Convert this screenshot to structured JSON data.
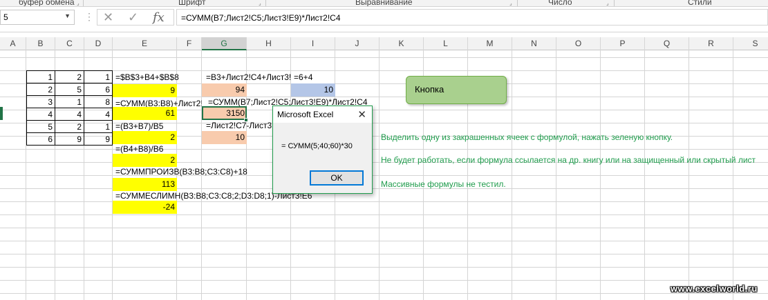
{
  "ribbon": {
    "groups": [
      "буфер обмена",
      "Шрифт",
      "Выравнивание",
      "Число",
      "Стили"
    ]
  },
  "formula_bar": {
    "name_box": "5",
    "cancel_icon": "✕",
    "enter_icon": "✓",
    "fx_label": "fx",
    "formula": "=СУММ(B7;Лист2!C5;Лист3!E9)*Лист2!C4"
  },
  "columns": [
    "A",
    "B",
    "C",
    "D",
    "E",
    "F",
    "G",
    "H",
    "I",
    "J",
    "K",
    "L",
    "M",
    "N",
    "O",
    "P",
    "Q",
    "R",
    "S"
  ],
  "selected_column": "G",
  "table_values": [
    [
      "1",
      "2",
      "1"
    ],
    [
      "2",
      "5",
      "6"
    ],
    [
      "3",
      "1",
      "8"
    ],
    [
      "4",
      "4",
      "4"
    ],
    [
      "5",
      "2",
      "1"
    ],
    [
      "6",
      "9",
      "9"
    ]
  ],
  "cells": {
    "e1": "=$B$3+B4+$B$8",
    "e2": "9",
    "e3": "=СУММ(B3:B8)+Лист2!",
    "e4": "61",
    "e5": "=(B3+B7)/B5",
    "e6": "2",
    "e7": "=(B4+B8)/B6",
    "e8": "2",
    "e9": "=СУММПРОИЗВ(B3:B8;C3:C8)+18",
    "e10": "113",
    "e11": "=СУММЕСЛИМН(B3:B8;C3:C8;2;D3:D8;1)-Лист3!E6",
    "e12": "-24",
    "g1": "=B3+Лист2!C4+Лист3!",
    "i1": "=6+4",
    "g2": "94",
    "i2": "10",
    "g3": "=СУММ(B7;Лист2!C5;Лист3!E9)*Лист2!C4",
    "g4": "3150",
    "g5": "=Лист2!C7-Лист3",
    "g6": "10"
  },
  "notes": [
    "Выделить одну из закрашенных ячеек с формулой, нажать зеленую кнопку.",
    "Не будет работать, если формула ссылается на др. книгу или на защищенный или скрытый лист",
    "Массивные формулы не тестил."
  ],
  "shape_button": "Кнопка",
  "dialog": {
    "title": "Microsoft Excel",
    "close": "✕",
    "message": "= СУММ(5;40;60)*30",
    "ok": "OK"
  },
  "watermark": "www.excelworld.ru",
  "colors": {
    "yellow": "#ffff00",
    "orange": "#f8cbad",
    "blue": "#b4c6e7",
    "button_green": "#a9d08e",
    "note_green": "#1e9b4b",
    "excel_green": "#217346"
  }
}
